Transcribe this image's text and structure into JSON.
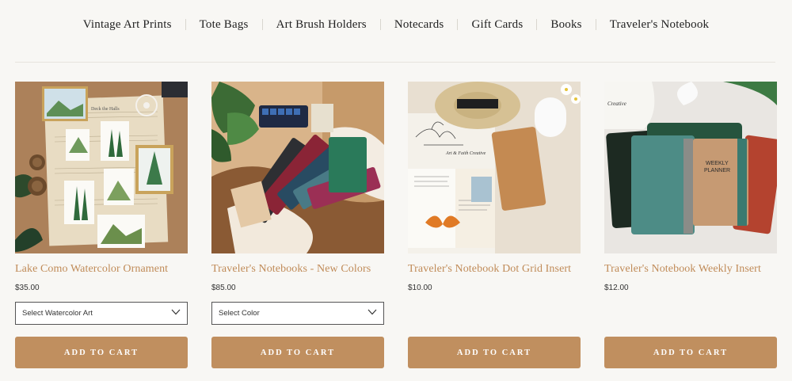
{
  "nav": {
    "items": [
      {
        "label": "Vintage Art Prints"
      },
      {
        "label": "Tote Bags"
      },
      {
        "label": "Art Brush Holders"
      },
      {
        "label": "Notecards"
      },
      {
        "label": "Gift Cards"
      },
      {
        "label": "Books"
      },
      {
        "label": "Traveler's Notebook"
      }
    ]
  },
  "products": [
    {
      "title": "Lake Como Watercolor Ornament",
      "price": "$35.00",
      "select": "Select Watercolor Art",
      "button": "ADD TO CART",
      "image_text": "Deck the Halls"
    },
    {
      "title": "Traveler's Notebooks - New Colors",
      "price": "$85.00",
      "select": "Select Color",
      "button": "ADD TO CART"
    },
    {
      "title": "Traveler's Notebook Dot Grid Insert",
      "price": "$10.00",
      "button": "ADD TO CART",
      "image_text": "Art & Faith Creative"
    },
    {
      "title": "Traveler's Notebook Weekly Insert",
      "price": "$12.00",
      "button": "ADD TO CART",
      "image_text_1": "WEEKLY",
      "image_text_2": "PLANNER",
      "image_text_3": "Creative"
    }
  ],
  "colors": {
    "accent": "#c08b58",
    "button": "#c08f5f",
    "background": "#f8f7f4"
  }
}
